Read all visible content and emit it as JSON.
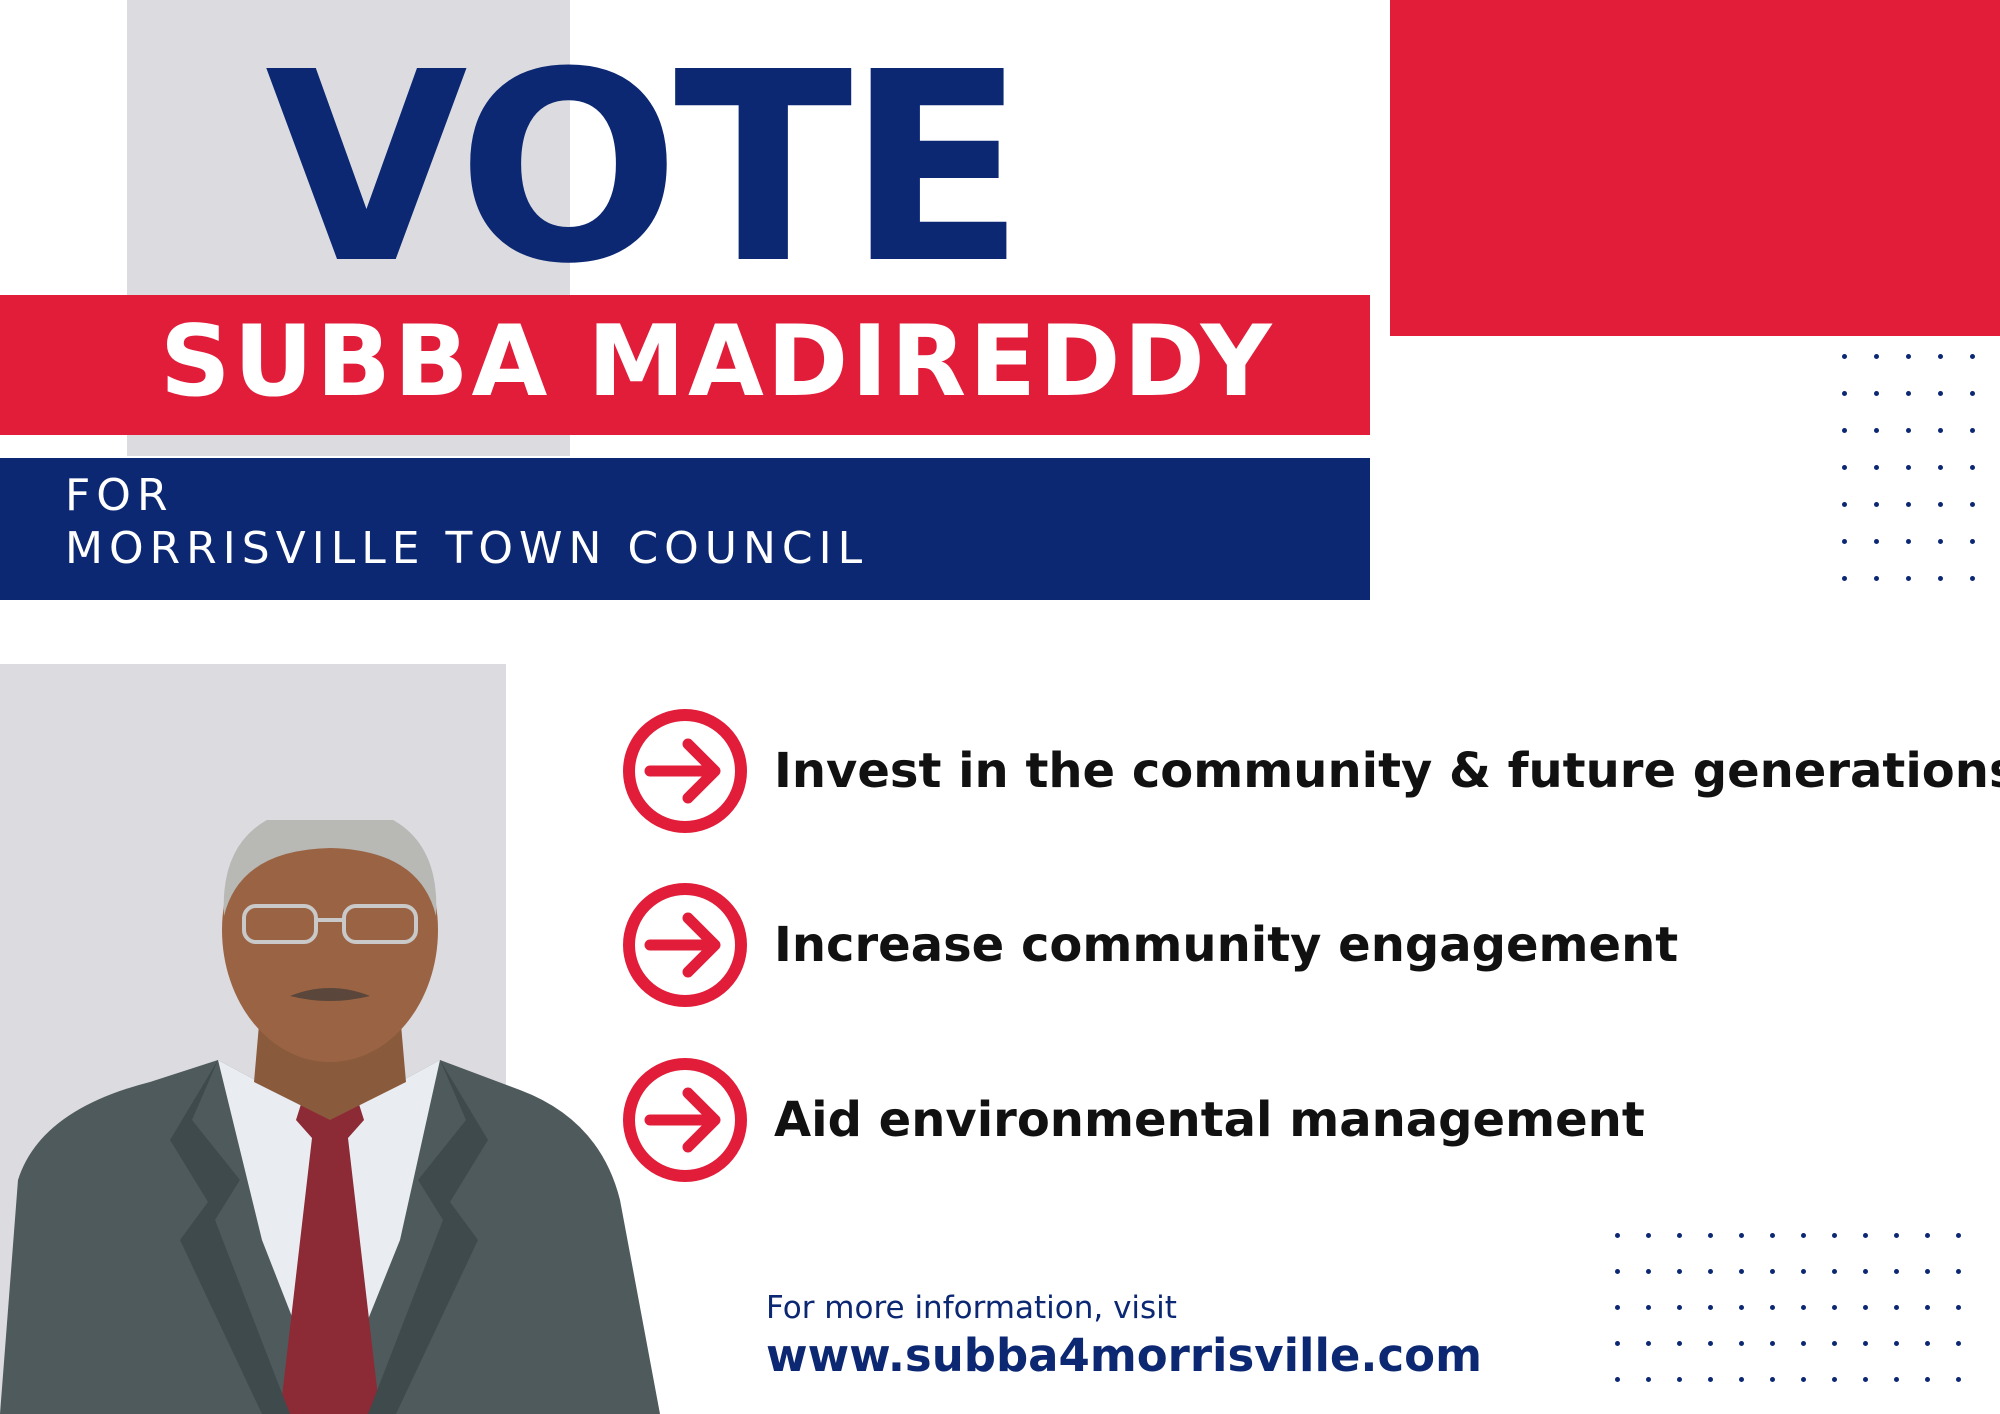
{
  "headline": {
    "vote": "VOTE",
    "candidate_name": "SUBBA MADIREDDY",
    "for": "FOR",
    "office": "MORRISVILLE TOWN COUNCIL"
  },
  "points": [
    {
      "text": "Invest in the community & future generations",
      "icon": "arrow-circle-icon"
    },
    {
      "text": "Increase community engagement",
      "icon": "arrow-circle-icon"
    },
    {
      "text": "Aid environmental management",
      "icon": "arrow-circle-icon"
    }
  ],
  "footer": {
    "info": "For more information, visit",
    "website": "www.subba4morrisville.com"
  },
  "colors": {
    "red": "#e21d3a",
    "navy": "#0c2873",
    "grey": "#dcdce0"
  }
}
